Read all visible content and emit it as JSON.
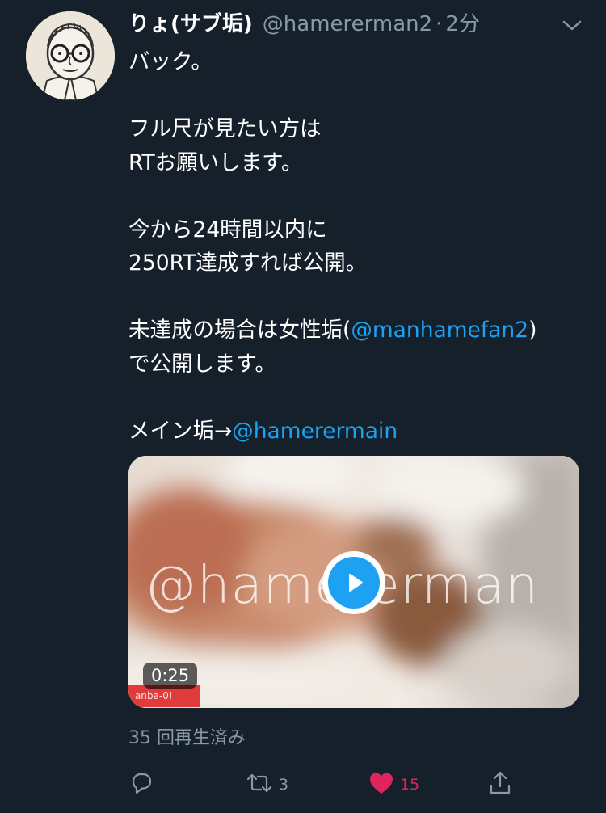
{
  "tweet": {
    "display_name": "りょ(サブ垢)",
    "handle": "@hamererman2",
    "separator": "·",
    "time": "2分",
    "lines": [
      {
        "text": "バック。"
      },
      {
        "text": ""
      },
      {
        "text": "フル尺が見たい方は"
      },
      {
        "text": "RTお願いします。"
      },
      {
        "text": ""
      },
      {
        "text": "今から24時間以内に"
      },
      {
        "text": "250RT達成すれば公開。"
      },
      {
        "text": ""
      },
      {
        "pre": "未達成の場合は女性垢(",
        "link": "@manhamefan2",
        "post": ")"
      },
      {
        "text": "で公開します。"
      },
      {
        "text": ""
      },
      {
        "pre": "メイン垢→",
        "link": "@hamerermain",
        "post": ""
      }
    ]
  },
  "media": {
    "watermark": "@hamererman",
    "duration": "0:25",
    "corner_tag": "anba-0!"
  },
  "views": "35 回再生済み",
  "actions": {
    "reply_icon": "reply-icon",
    "retweet_icon": "retweet-icon",
    "retweet_count": "3",
    "like_icon": "heart-icon",
    "like_count": "15",
    "share_icon": "share-icon"
  },
  "colors": {
    "background": "#15202b",
    "accent": "#1da1f2",
    "secondary_text": "#8899a6",
    "like": "#e0245e"
  }
}
